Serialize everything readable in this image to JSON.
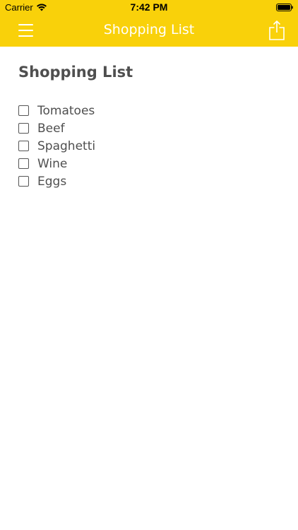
{
  "colors": {
    "header": "#f9d10a",
    "header_text": "#ffffff",
    "body_text": "#4f4f4f"
  },
  "status_bar": {
    "carrier": "Carrier",
    "time": "7:42 PM"
  },
  "nav": {
    "title": "Shopping List",
    "left_icon": "hamburger-menu-icon",
    "right_icon": "share-icon"
  },
  "list": {
    "title": "Shopping List",
    "items": [
      {
        "label": "Tomatoes",
        "checked": false
      },
      {
        "label": "Beef",
        "checked": false
      },
      {
        "label": "Spaghetti",
        "checked": false
      },
      {
        "label": "Wine",
        "checked": false
      },
      {
        "label": "Eggs",
        "checked": false
      }
    ]
  }
}
